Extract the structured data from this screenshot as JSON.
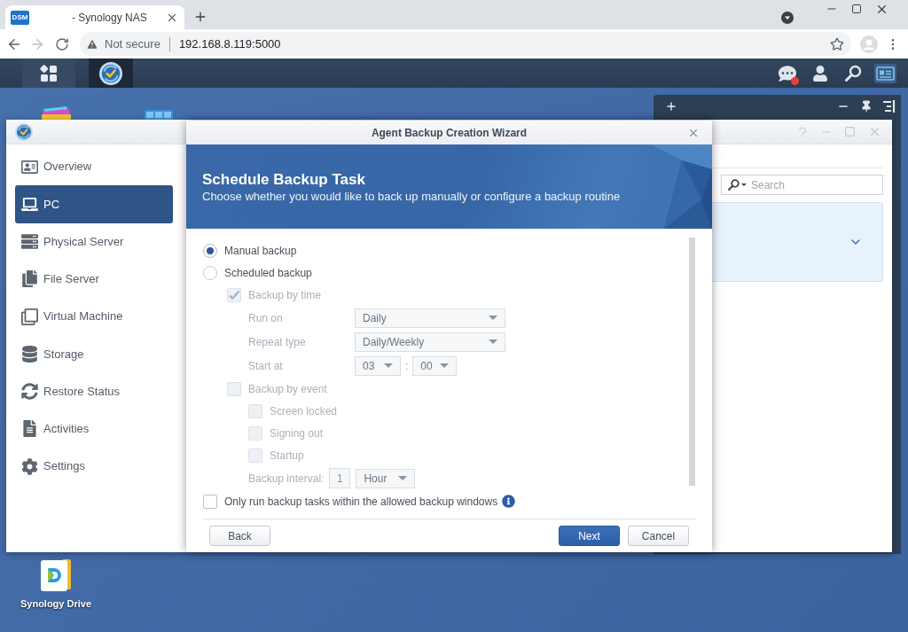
{
  "browser": {
    "tab": {
      "favicon_text": "DSM",
      "title": "- Synology NAS"
    },
    "address_bar": {
      "security_label": "Not secure",
      "url": "192.168.8.119:5000"
    }
  },
  "taskbar": {
    "buttons": [
      {
        "kind": "main-menu",
        "selected": false
      },
      {
        "kind": "app",
        "selected": true
      }
    ],
    "notifications": {
      "unread": true
    }
  },
  "desktop": {
    "shortcuts": [
      {
        "label": "Synology Drive"
      }
    ]
  },
  "app_window": {
    "sidebar": {
      "items": [
        {
          "label": "Overview",
          "selected": false
        },
        {
          "label": "PC",
          "selected": true
        },
        {
          "label": "Physical Server",
          "selected": false
        },
        {
          "label": "File Server",
          "selected": false
        },
        {
          "label": "Virtual Machine",
          "selected": false
        },
        {
          "label": "Storage",
          "selected": false
        },
        {
          "label": "Restore Status",
          "selected": false
        },
        {
          "label": "Activities",
          "selected": false
        },
        {
          "label": "Settings",
          "selected": false
        }
      ]
    },
    "search": {
      "placeholder": "Search"
    }
  },
  "wizard": {
    "title": "Agent Backup Creation Wizard",
    "heading": "Schedule Backup Task",
    "description": "Choose whether you would like to back up manually or configure a backup routine",
    "options": [
      {
        "kind": "radio",
        "label": "Manual backup",
        "selected": true
      },
      {
        "kind": "radio",
        "label": "Scheduled backup",
        "selected": false,
        "children": [
          {
            "kind": "checkbox",
            "label": "Backup by time",
            "checked": true,
            "disabled": true,
            "children": [
              {
                "kind": "select",
                "label": "Run on",
                "value": "Daily",
                "disabled": true
              },
              {
                "kind": "select",
                "label": "Repeat type",
                "value": "Daily/Weekly",
                "disabled": true
              },
              {
                "kind": "time",
                "label": "Start at",
                "hour": "03",
                "separator": ":",
                "minute": "00",
                "disabled": true
              }
            ]
          },
          {
            "kind": "checkbox",
            "label": "Backup by event",
            "checked": false,
            "disabled": true,
            "children": [
              {
                "kind": "checkbox",
                "label": "Screen locked",
                "checked": false,
                "disabled": true
              },
              {
                "kind": "checkbox",
                "label": "Signing out",
                "checked": false,
                "disabled": true
              },
              {
                "kind": "checkbox",
                "label": "Startup",
                "checked": false,
                "disabled": true
              },
              {
                "kind": "interval",
                "label": "Backup interval:",
                "value": "1",
                "unit": "Hour",
                "disabled": true
              }
            ]
          }
        ]
      }
    ],
    "backup_window_option": {
      "kind": "checkbox",
      "label": "Only run backup tasks within the allowed backup windows",
      "checked": false,
      "info": true
    },
    "footer": {
      "left": [
        {
          "label": "Back",
          "kind": "default"
        }
      ],
      "right": [
        {
          "label": "Next",
          "kind": "primary"
        },
        {
          "label": "Cancel",
          "kind": "default"
        }
      ]
    }
  }
}
